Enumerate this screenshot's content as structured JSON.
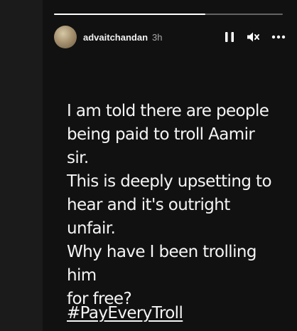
{
  "story": {
    "progress_fraction": 0.66,
    "username": "advaitchandan",
    "time": "3h",
    "icons": {
      "pause": "pause-icon",
      "mute": "speaker-muted-icon",
      "more": "more-horizontal-icon"
    },
    "caption_lines": [
      "I am told there are people",
      "being paid to troll Aamir sir.",
      "This is deeply upsetting to",
      "hear and it's outright unfair.",
      "Why have I been trolling him",
      "for free?"
    ],
    "hashtag": "#PayEveryTroll"
  },
  "colors": {
    "page_background": "#1b1b1b",
    "story_background": "#111111",
    "text": "#f5f5f5",
    "muted_text": "#a9a9a9"
  }
}
